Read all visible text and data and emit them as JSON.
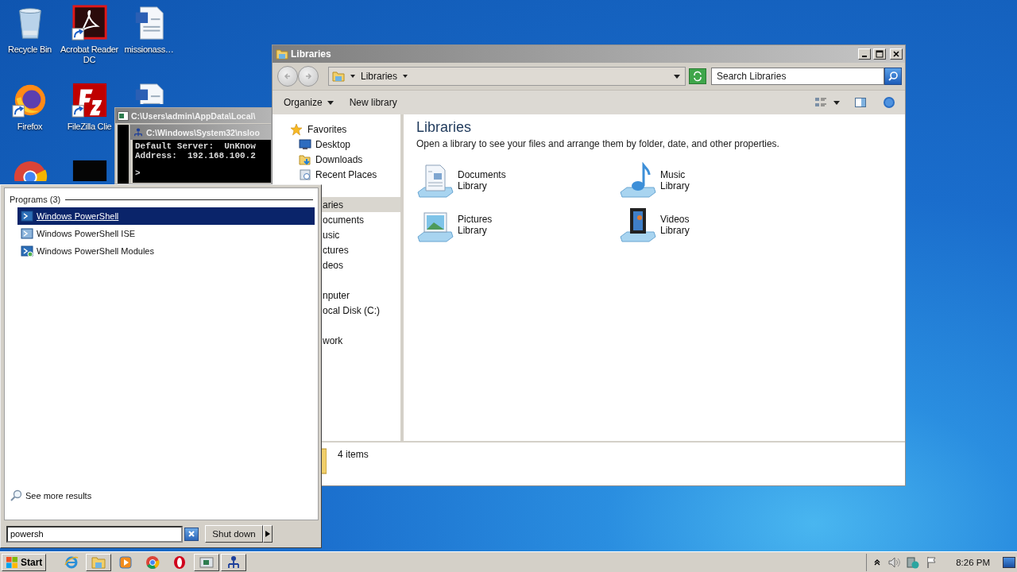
{
  "desktop": {
    "icons": [
      {
        "kind": "recycle",
        "label": "Recycle Bin"
      },
      {
        "kind": "firefox",
        "label": "Firefox",
        "shortcut": true
      },
      {
        "kind": "chrome"
      },
      {
        "kind": "acrobat",
        "label": "Acrobat Reader DC",
        "shortcut": true
      },
      {
        "kind": "filezilla",
        "label": "FileZilla Clie",
        "shortcut": true
      },
      {
        "kind": "dark"
      },
      {
        "kind": "word",
        "label": "missionass…"
      },
      {
        "kind": "word"
      }
    ]
  },
  "console": {
    "title": "C:\\Users\\admin\\AppData\\Local\\",
    "inner": {
      "title": "C:\\Windows\\System32\\nsloo",
      "lines": [
        "Default Server:  UnKnow",
        "Address:  192.168.100.2",
        ">"
      ]
    }
  },
  "explorer": {
    "title": "Libraries",
    "breadcrumb": "Libraries",
    "search": {
      "placeholder": "Search Libraries"
    },
    "toolbar": [
      {
        "label": "Organize",
        "menu": true
      },
      {
        "label": "New library"
      }
    ],
    "nav": [
      {
        "label": "Favorites",
        "kind": "favorites",
        "selected": false,
        "children": [
          {
            "label": "Desktop",
            "kind": "desktop",
            "selected": false
          },
          {
            "label": "Downloads",
            "kind": "downloads",
            "selected": false
          },
          {
            "label": "Recent Places",
            "kind": "recent",
            "selected": false
          }
        ]
      },
      {
        "label": "aries",
        "kind": "covered",
        "selected": true,
        "children": [
          {
            "label": "ocuments",
            "kind": "covered",
            "selected": false
          },
          {
            "label": "usic",
            "kind": "covered",
            "selected": false
          },
          {
            "label": "ctures",
            "kind": "covered",
            "selected": false
          },
          {
            "label": "deos",
            "kind": "covered",
            "selected": false
          }
        ]
      },
      {
        "label": "nputer",
        "kind": "covered",
        "selected": false,
        "children": [
          {
            "label": "ocal Disk (C:)",
            "kind": "covered",
            "selected": false
          }
        ]
      },
      {
        "label": "work",
        "kind": "covered",
        "selected": false
      }
    ],
    "heading": "Libraries",
    "description": "Open a library to see your files and arrange them by folder, date, and other properties.",
    "libraries": [
      {
        "name": "Documents",
        "type": "Library",
        "kind": "documents"
      },
      {
        "name": "Music",
        "type": "Library",
        "kind": "music"
      },
      {
        "name": "Pictures",
        "type": "Library",
        "kind": "pictures"
      },
      {
        "name": "Videos",
        "type": "Library",
        "kind": "videos"
      }
    ],
    "status": "4 items"
  },
  "start_menu": {
    "section": "Programs (3)",
    "programs": [
      {
        "label": "Windows PowerShell",
        "kind": "powershell",
        "selected": true
      },
      {
        "label": "Windows PowerShell ISE",
        "kind": "ise",
        "selected": false
      },
      {
        "label": "Windows PowerShell Modules",
        "kind": "modules",
        "selected": false
      }
    ],
    "see_more": "See more results",
    "search": {
      "value": "powersh"
    },
    "shutdown": "Shut down"
  },
  "taskbar": {
    "start": "Start",
    "apps": [
      {
        "kind": "ie",
        "open": false
      },
      {
        "kind": "folder",
        "open": true
      },
      {
        "kind": "media",
        "open": false
      },
      {
        "kind": "chrome",
        "open": false
      },
      {
        "kind": "opera",
        "open": false
      },
      {
        "kind": "console",
        "open": true
      },
      {
        "kind": "network",
        "open": true
      }
    ],
    "clock": "8:26 PM"
  }
}
